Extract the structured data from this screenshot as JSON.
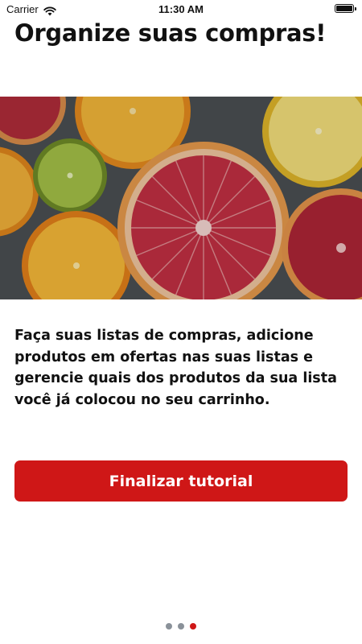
{
  "status_bar": {
    "carrier": "Carrier",
    "time": "11:30 AM"
  },
  "page": {
    "title": "Organize suas compras!",
    "description": "Faça suas listas de compras, adicione produtos em ofertas nas suas listas e gerencie quais dos produtos da sua lista você já colocou no seu carrinho.",
    "button_label": "Finalizar tutorial"
  },
  "pager": {
    "total": 3,
    "active_index": 2
  },
  "colors": {
    "accent": "#cf1717",
    "inactive_dot": "#8a9199"
  }
}
